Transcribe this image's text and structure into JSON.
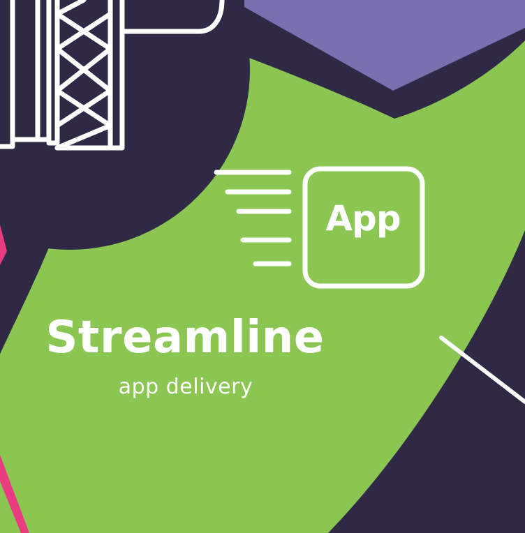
{
  "colors": {
    "background": "#2f2946",
    "green": "#8bc552",
    "purple": "#7a6fb1",
    "pink": "#e93b7f",
    "white": "#ffffff"
  },
  "icons": [
    "tower-icon",
    "app-icon",
    "speed-lines-icon"
  ],
  "app_icon": {
    "label": "App"
  },
  "headline": "Streamline",
  "subline": "app delivery"
}
